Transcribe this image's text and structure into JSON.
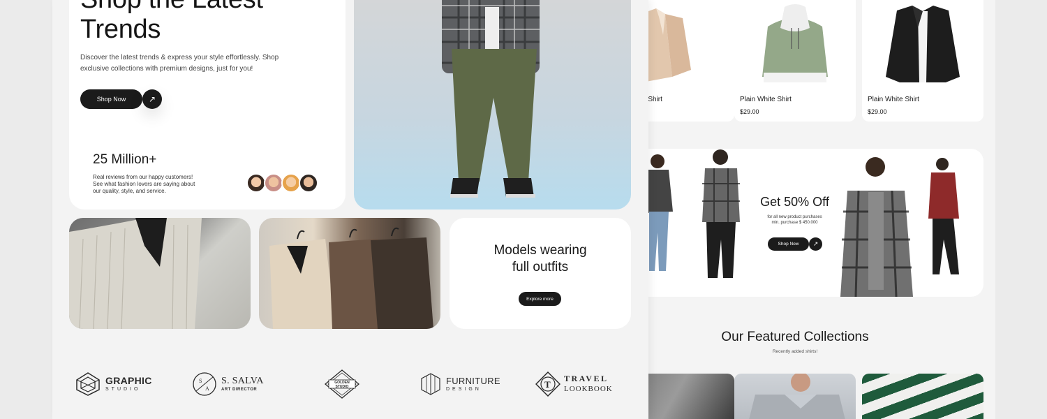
{
  "hero": {
    "title_line1": "Shop the Latest",
    "title_line2": "Trends",
    "description": "Discover the latest trends & express your style effortlessly. Shop exclusive collections with premium designs, just for you!",
    "shop_button": "Shop Now",
    "stat_value": "25 Million+",
    "stat_description": "Real reviews from our happy customers! See what fashion lovers are saying about our quality, style, and service."
  },
  "outfits": {
    "title_line1": "Models wearing",
    "title_line2": "full outfits",
    "button": "Explore more"
  },
  "logos": [
    {
      "main": "GRAPHIC",
      "sub": "STUDIO"
    },
    {
      "main": "S. SALVA",
      "sub": "ART DIRECTOR"
    },
    {
      "main": "GOLDEN STUDIO",
      "sub": ""
    },
    {
      "main": "FURNITURE",
      "sub": "DESIGN"
    },
    {
      "main": "TRAVEL",
      "sub": "LOOKBOOK"
    }
  ],
  "products": [
    {
      "name": "e Shirt",
      "price": ""
    },
    {
      "name": "Plain White Shirt",
      "price": "$29.00"
    },
    {
      "name": "Plain White Shirt",
      "price": "$29.00"
    }
  ],
  "promo": {
    "title": "Get 50% Off",
    "subtitle_line1": "for all new product purchases",
    "subtitle_line2": "min. purchase $ 450.000",
    "button": "Shop Now"
  },
  "featured": {
    "title": "Our Featured Collections",
    "subtitle": "Recently added shirts!"
  }
}
